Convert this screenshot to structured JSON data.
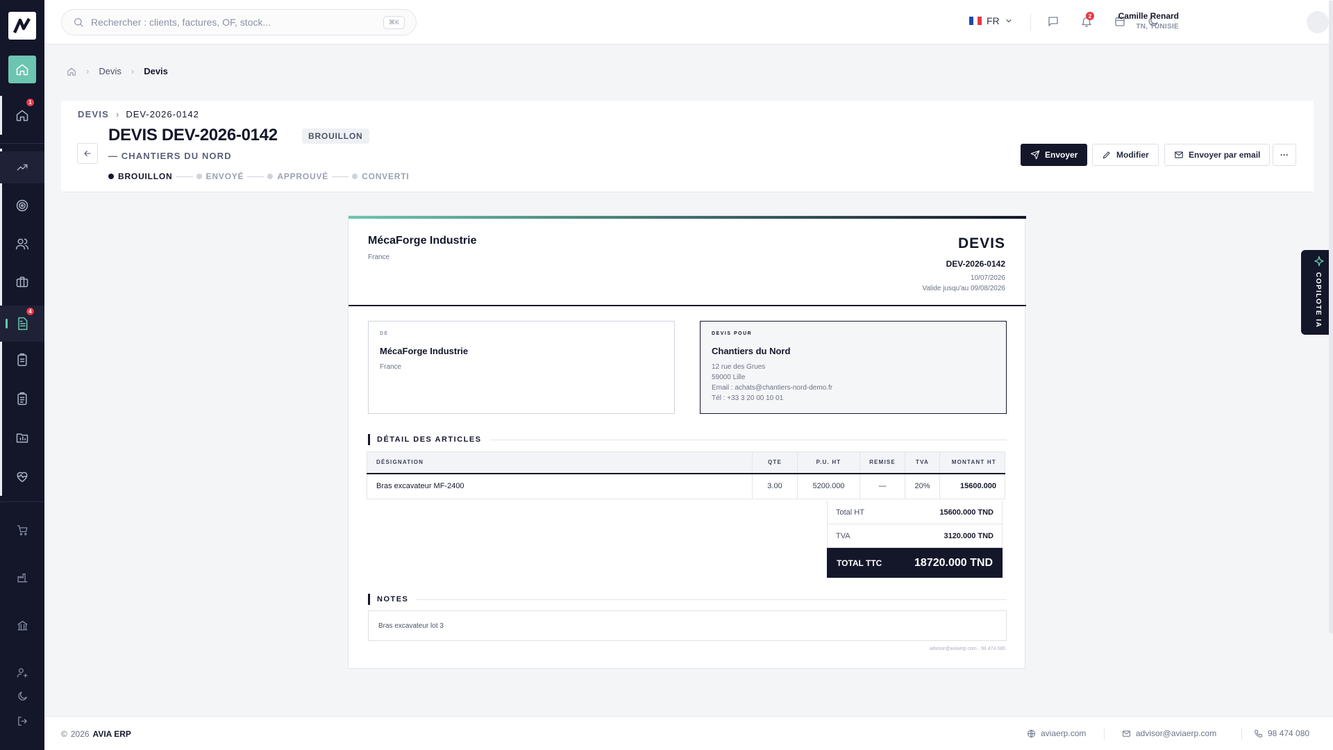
{
  "search": {
    "placeholder": "Rechercher : clients, factures, OF, stock...",
    "shortcut": "⌘K"
  },
  "topbar": {
    "lang": "FR",
    "notif_count": "2",
    "user": {
      "name": "Camille Renard",
      "region": "TN, TUNISIE"
    }
  },
  "sidebar": {
    "badge_home": "1",
    "badge_devis": "4"
  },
  "breadcrumb": [
    "Devis",
    "Devis"
  ],
  "header": {
    "sub_section": "DEVIS",
    "sub_ref": "DEV-2026-0142",
    "title": "DEVIS DEV-2026-0142",
    "status": "BROUILLON",
    "client": "— CHANTIERS DU NORD",
    "steps": [
      "BROUILLON",
      "ENVOYÉ",
      "APPROUVÉ",
      "CONVERTI"
    ],
    "actions": {
      "send": "Envoyer",
      "edit": "Modifier",
      "email": "Envoyer par email",
      "more": "···"
    }
  },
  "document": {
    "company": "MécaForge Industrie",
    "company_country": "France",
    "doc_type": "DEVIS",
    "doc_number": "DEV-2026-0142",
    "date": "10/07/2026",
    "valid_until": "Valide jusqu'au 09/08/2026",
    "from": {
      "label": "DE",
      "name": "MécaForge Industrie",
      "country": "France"
    },
    "to": {
      "label": "DEVIS POUR",
      "name": "Chantiers du Nord",
      "address": "12 rue des Grues",
      "city": "59000 Lille",
      "email": "Email : achats@chantiers-nord-demo.fr",
      "phone": "Tél : +33 3 20 00 10 01"
    },
    "items_title": "DÉTAIL DES ARTICLES",
    "columns": [
      "DÉSIGNATION",
      "QTE",
      "P.U. HT",
      "REMISE",
      "TVA",
      "MONTANT HT"
    ],
    "rows": [
      {
        "designation": "Bras excavateur MF-2400",
        "qte": "3.00",
        "pu": "5200.000",
        "remise": "—",
        "tva": "20%",
        "montant": "15600.000"
      }
    ],
    "totals": {
      "ht_label": "Total HT",
      "ht": "15600.000 TND",
      "tva_label": "TVA",
      "tva": "3120.000 TND",
      "ttc_label": "TOTAL TTC",
      "ttc": "18720.000 TND"
    },
    "notes_title": "NOTES",
    "notes": "Bras excavateur lot 3",
    "footer": "advisor@aviaerp.com · 98 474 080"
  },
  "copilot": "COPILOTE IA",
  "footer": {
    "year": "2026",
    "brand": "AVIA ERP",
    "site": "aviaerp.com",
    "email": "advisor@aviaerp.com",
    "phone": "98 474 080"
  },
  "colors": {
    "accent": "#6cc5b0",
    "dark": "#14162a",
    "badge": "#e53945"
  }
}
